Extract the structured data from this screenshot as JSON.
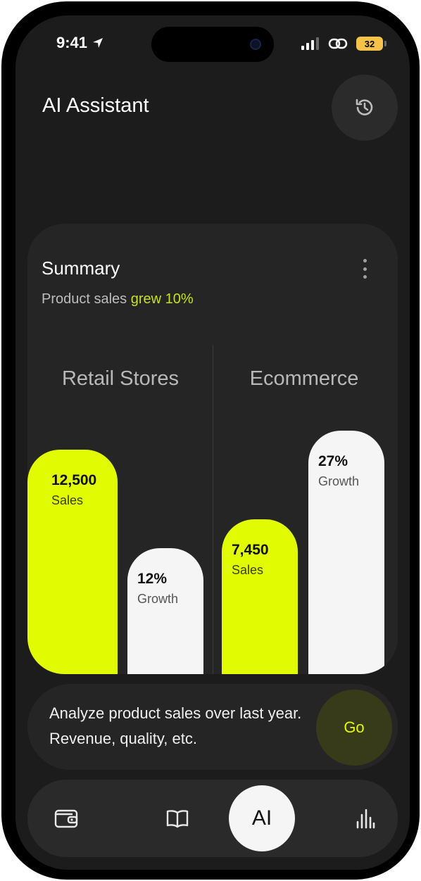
{
  "status": {
    "time": "9:41",
    "battery": "32"
  },
  "header": {
    "title": "AI Assistant"
  },
  "summary": {
    "title": "Summary",
    "subtitle_prefix": "Product sales ",
    "subtitle_highlight": "grew 10%",
    "groups": [
      {
        "title": "Retail Stores",
        "bars": [
          {
            "value": "12,500",
            "label": "Sales",
            "level": 0.84
          },
          {
            "value": "12%",
            "label": "Growth",
            "level": 0.47
          }
        ]
      },
      {
        "title": "Ecommerce",
        "bars": [
          {
            "value": "7,450",
            "label": "Sales",
            "level": 0.58
          },
          {
            "value": "27%",
            "label": "Growth",
            "level": 0.91
          }
        ]
      }
    ]
  },
  "prompt": {
    "text": "Analyze product sales over last year. Revenue, quality, etc.",
    "go_label": "Go"
  },
  "tabbar": {
    "ai_label": "AI"
  },
  "colors": {
    "accent": "#e0fb02",
    "background": "#1c1c1c",
    "card": "#252525"
  }
}
